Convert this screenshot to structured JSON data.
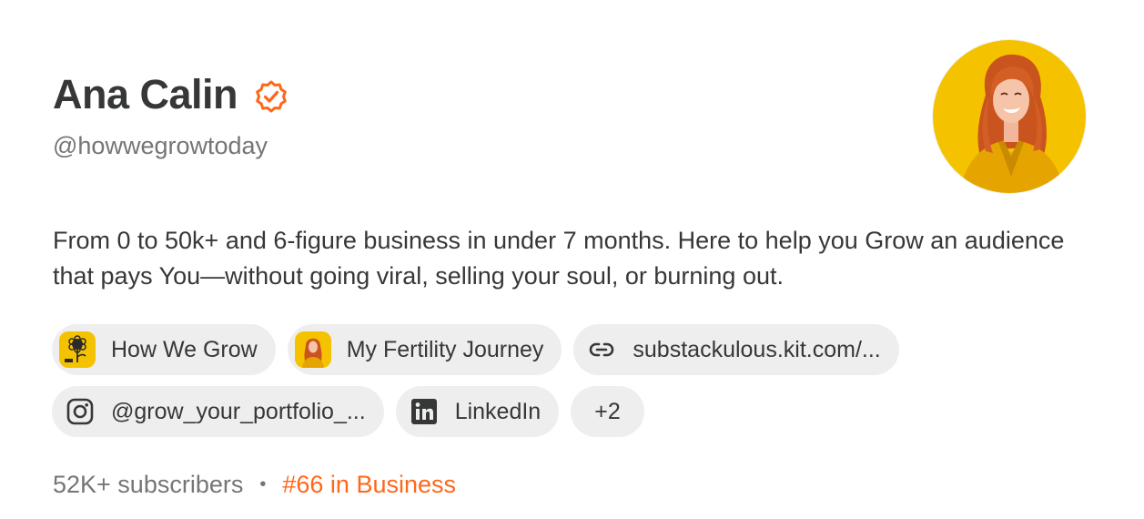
{
  "profile": {
    "name": "Ana Calin",
    "handle": "@howwegrowtoday",
    "bio": "From 0 to 50k+ and 6-figure business in under 7 months. Here to help you Grow an audience that pays You—without going viral, selling your soul, or burning out."
  },
  "links": [
    {
      "label": "How We Grow",
      "icon": "sunflower-thumbnail"
    },
    {
      "label": "My Fertility Journey",
      "icon": "profile-photo-thumbnail"
    },
    {
      "label": "substackulous.kit.com/...",
      "icon": "link-icon"
    },
    {
      "label": "@grow_your_portfolio_...",
      "icon": "instagram-icon"
    },
    {
      "label": "LinkedIn",
      "icon": "linkedin-icon"
    },
    {
      "label": "+2"
    }
  ],
  "stats": {
    "subscribers": "52K+ subscribers",
    "separator": "•",
    "rank": "#66 in Business"
  },
  "colors": {
    "accent": "#ff6719",
    "text": "#363737",
    "muted": "#757575",
    "chip_bg": "#eeeeee",
    "avatar_bg": "#f5c200"
  }
}
